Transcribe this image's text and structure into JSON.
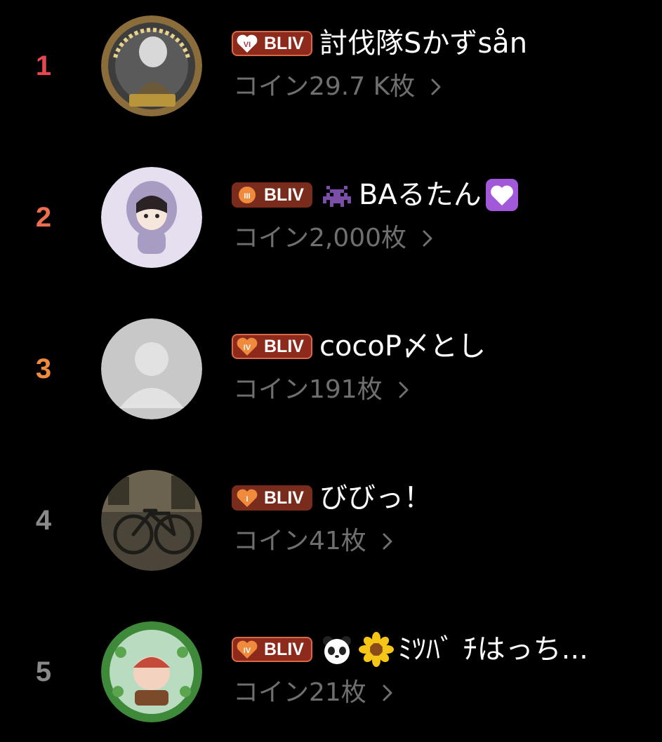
{
  "colors": {
    "rank_1": "#e6484f",
    "rank_2": "#ee6e4e",
    "rank_3": "#f08a3c",
    "rank_other": "#8a8a8a",
    "coin_text": "#6f6f6f",
    "badge_red": "#8e2a1c",
    "badge_border": "#d9674a"
  },
  "ranking": [
    {
      "rank": "1",
      "badge_level": "VI",
      "badge_label": "BLIV",
      "badge_style": "red",
      "name": "討伐隊Sかずsån",
      "coins": "コイン29.7 K枚",
      "avatar_icon": "sponsor-emblem-avatar",
      "name_emojis": []
    },
    {
      "rank": "2",
      "badge_level": "III",
      "badge_label": "BLIV",
      "badge_style": "brown",
      "name": "BAるたん",
      "coins": "コイン2,000枚",
      "avatar_icon": "hooded-girl-avatar",
      "name_emojis": [
        "space-invader-icon",
        "white-heart-icon"
      ]
    },
    {
      "rank": "3",
      "badge_level": "IV",
      "badge_label": "BLIV",
      "badge_style": "red",
      "name": "cocoP〆とし",
      "coins": "コイン191枚",
      "avatar_icon": "default-user-avatar",
      "name_emojis": []
    },
    {
      "rank": "4",
      "badge_level": "I",
      "badge_label": "BLIV",
      "badge_style": "brown",
      "name": "びびっ！",
      "coins": "コイン41枚",
      "avatar_icon": "bicycle-photo-avatar",
      "name_emojis": []
    },
    {
      "rank": "5",
      "badge_level": "IV",
      "badge_label": "BLIV",
      "badge_style": "red",
      "name": "ﾐﾂﾊﾞ ﾁはっち...",
      "coins": "コイン21枚",
      "avatar_icon": "clover-character-avatar",
      "name_emojis": [
        "panda-face-icon",
        "sunflower-icon"
      ]
    }
  ]
}
